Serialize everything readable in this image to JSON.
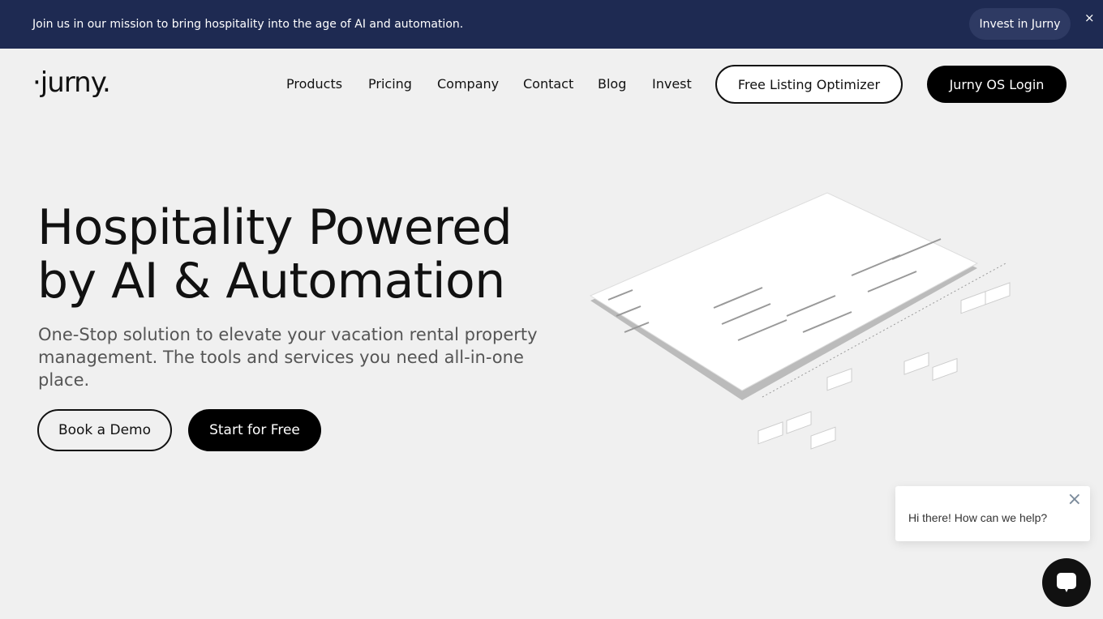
{
  "banner": {
    "text": "Join us in our mission to bring hospitality into the age of AI and automation.",
    "button": "Invest in Jurny",
    "close": "×"
  },
  "header": {
    "logo": "·jurny.",
    "nav": [
      "Products",
      "Pricing",
      "Company",
      "Contact",
      "Blog",
      "Invest"
    ],
    "optimizer": "Free Listing Optimizer",
    "login": "Jurny OS Login"
  },
  "hero": {
    "title_line1": "Hospitality Powered",
    "title_line2": "by AI & Automation",
    "subtitle": "One-Stop solution to elevate your vacation rental property management. The tools and services you need all-in-one place.",
    "demo": "Book a Demo",
    "free": "Start for Free"
  },
  "chat": {
    "message": "Hi there! How can we help?",
    "close": "×"
  }
}
